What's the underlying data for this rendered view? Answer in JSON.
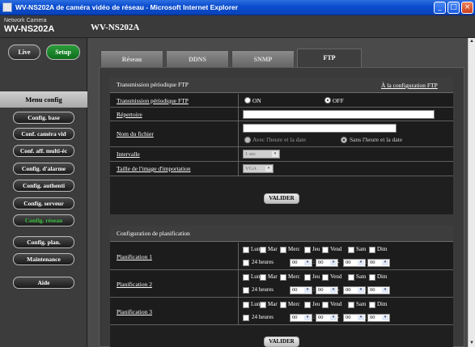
{
  "window": {
    "title": "WV-NS202A de caméra vidéo de réseau - Microsoft Internet Explorer",
    "minimize": "_",
    "maximize": "□",
    "close": "×"
  },
  "header": {
    "network_camera": "Network Camera",
    "model": "WV-NS202A",
    "model_title": "WV-NS202A"
  },
  "left": {
    "live": "Live",
    "setup": "Setup",
    "menu_title": "Menu config",
    "items": [
      "Config. base",
      "Conf. caméra vid",
      "Conf. aff. multi-éc",
      "Config. d'alarme",
      "Config. authenti",
      "Config. serveur",
      "Config. réseau",
      "Config. plan.",
      "Maintenance",
      "Aide"
    ]
  },
  "tabs": [
    "Réseau",
    "DDNS",
    "SNMP",
    "FTP"
  ],
  "ftp": {
    "title": "Transmission périodique FTP",
    "config_link": "À la configuration FTP",
    "transmission_label": "Transmission périodique FTP",
    "on": "ON",
    "off": "OFF",
    "repertoire_label": "Répertoire",
    "repertoire_value": "",
    "filename_label": "Nom du fichier",
    "filename_value": "",
    "with_time": "Avec l'heure et la date",
    "without_time": "Sans l'heure et la date",
    "interval_label": "Intervalle",
    "interval_value": "1 sec",
    "size_label": "Taille de l'image d'importation",
    "size_value": "VGA",
    "valider": "VALIDER"
  },
  "schedule": {
    "title": "Configuration de planification",
    "days": [
      "Lun",
      "Mar",
      "Merc",
      "Jeu",
      "Vend",
      "Sam",
      "Dim"
    ],
    "hours24": "24 heures",
    "time_value": "00",
    "dash": "-",
    "colon": ":",
    "rows": [
      {
        "label": "Planification 1"
      },
      {
        "label": "Planification 2"
      },
      {
        "label": "Planification 3"
      }
    ],
    "valider": "VALIDER"
  },
  "icons": {
    "dropdown": "▾",
    "scroll_up": "▲",
    "scroll_down": "▼"
  },
  "colors": {
    "titlebar": "#0c4ed0",
    "setup_green": "#1f8a2c",
    "active_menu": "#3cc440"
  }
}
